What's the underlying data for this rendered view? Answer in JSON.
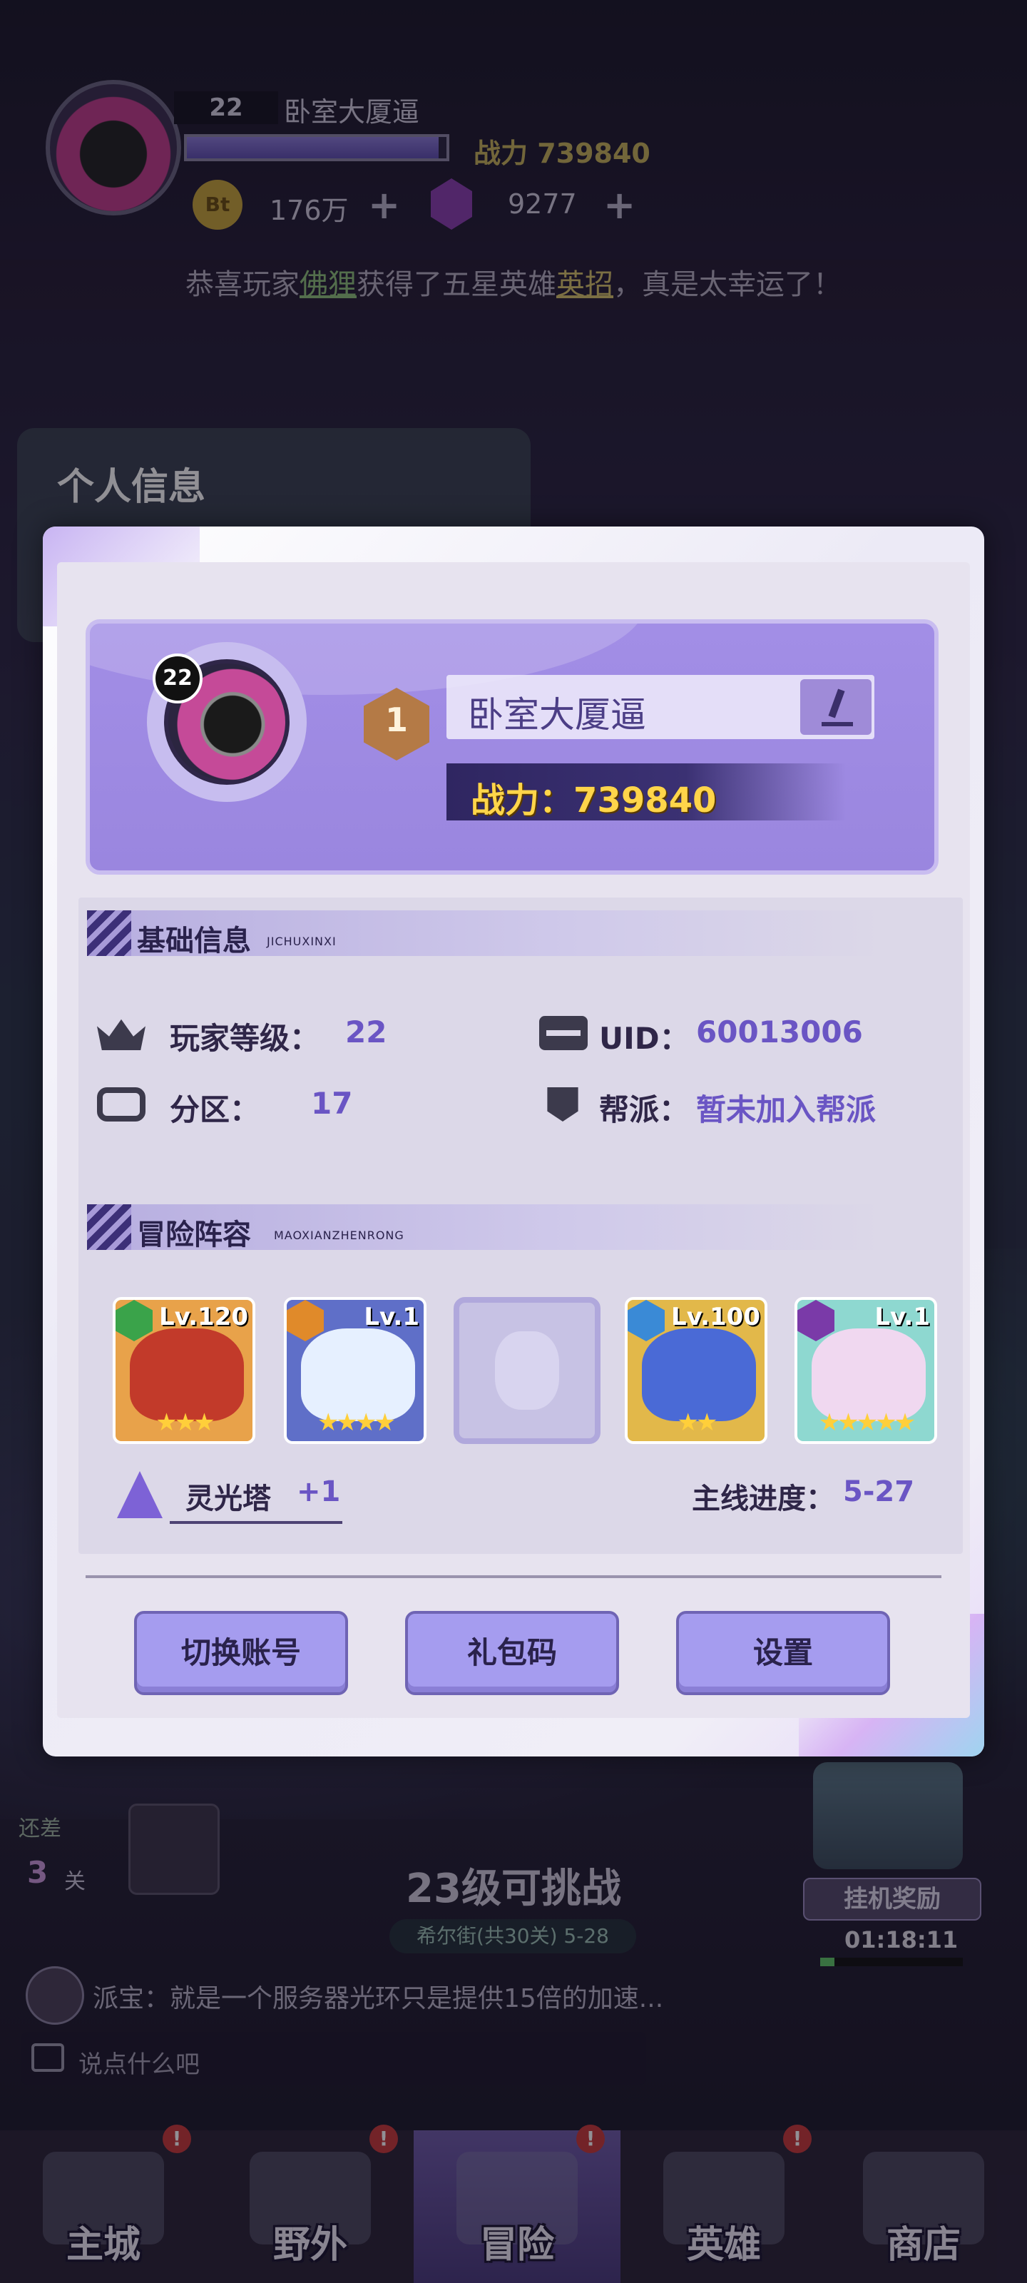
{
  "hud": {
    "level": "22",
    "player_name": "卧室大厦逼",
    "xp_fraction": 0.97,
    "power_text": "战力 739840",
    "coin_label": "Bt",
    "coin_value": "176万",
    "gem_value": "9277",
    "plus": "+"
  },
  "announcement": {
    "prefix": "恭喜玩家",
    "player": "佛狸",
    "middle": "获得了五星英雄",
    "hero": "英招",
    "suffix": "，真是太幸运了！"
  },
  "page_heading": "个人信息",
  "profile": {
    "avatar_level": "22",
    "rank": "1",
    "name": "卧室大厦逼",
    "power_label": "战力：",
    "power_value": "739840"
  },
  "basic_info": {
    "title": "基础信息",
    "subtitle": "JICHUXINXI",
    "player_level_label": "玩家等级：",
    "player_level": "22",
    "uid_label": "UID：",
    "uid": "60013006",
    "server_label": "分区：",
    "server": "17",
    "guild_label": "帮派：",
    "guild": "暂未加入帮派"
  },
  "lineup": {
    "title": "冒险阵容",
    "subtitle": "MAOXIANZHENRONG",
    "heroes": [
      {
        "level": "Lv.120",
        "stars": "★★★",
        "element_color": "#3aa34a",
        "card_bg": "#e8a24a",
        "face": "#c23a2a"
      },
      {
        "level": "Lv.1",
        "stars": "★★★★",
        "element_color": "#e08a2a",
        "card_bg": "#5f6fc8",
        "face": "#e6f0ff"
      },
      {
        "level": "Lv.100",
        "stars": "★★",
        "element_color": "#3a8ad6",
        "card_bg": "#e2b84a",
        "face": "#4a6ad6"
      },
      {
        "level": "Lv.1",
        "stars": "★★★★★",
        "element_color": "#7a3aa8",
        "card_bg": "#8ed8d0",
        "face": "#f0d8f0"
      }
    ],
    "tower_name": "灵光塔",
    "tower_bonus": "+1",
    "mainline_label": "主线进度：",
    "mainline_value": "5-27"
  },
  "actions": {
    "switch_account": "切换账号",
    "gift_code": "礼包码",
    "settings": "设置"
  },
  "bottom_hud": {
    "remain_label": "还差",
    "remain_num": "3",
    "remain_unit": "关",
    "challenge_text": "23级可挑战",
    "stage_text": "希尔街(共30关) 5-28",
    "idle_reward": "挂机奖励",
    "idle_time": "01:18:11",
    "idle_progress": 0.1
  },
  "chat": {
    "message": "派宝：就是一个服务器光环只是提供15倍的加速...",
    "placeholder": "说点什么吧"
  },
  "nav": [
    {
      "label": "主城",
      "badge": "!"
    },
    {
      "label": "野外",
      "badge": "!"
    },
    {
      "label": "冒险",
      "badge": "!"
    },
    {
      "label": "英雄",
      "badge": "!"
    },
    {
      "label": "商店",
      "badge": ""
    }
  ],
  "colors": {
    "accent": "#a59cef",
    "power_gold": "#ffd54a",
    "value_purple": "#6a55c4"
  }
}
